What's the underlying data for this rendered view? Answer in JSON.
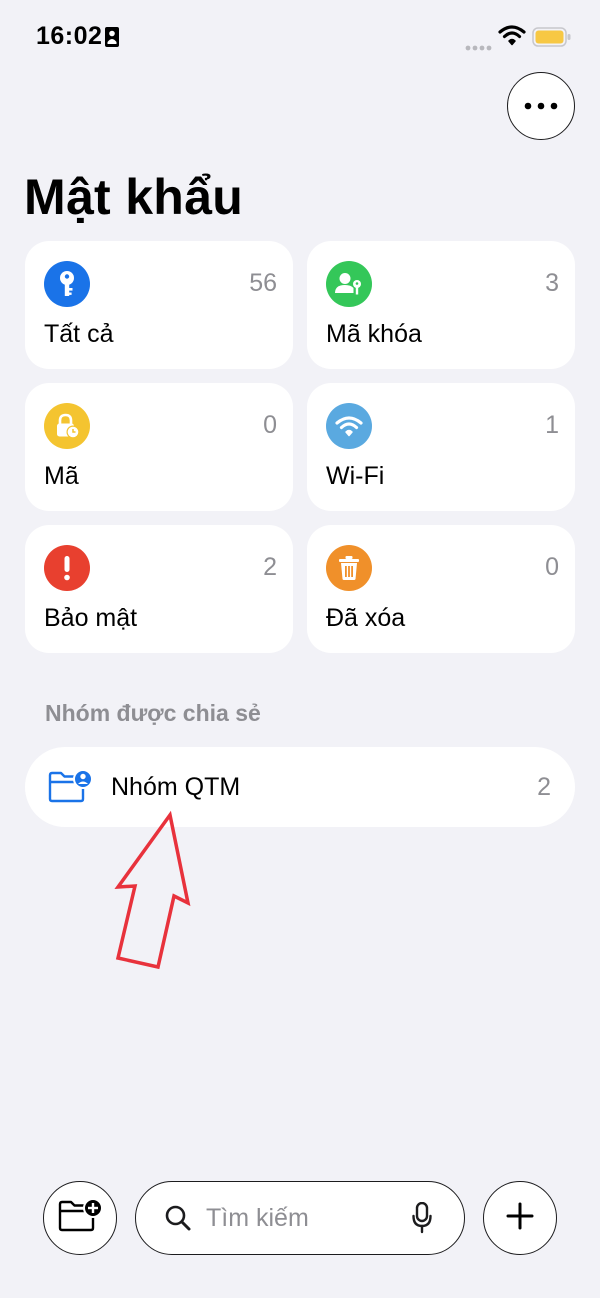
{
  "status_bar": {
    "time": "16:02",
    "icons": [
      "portrait-lock-icon",
      "signal-icon",
      "wifi-icon",
      "battery-icon"
    ],
    "battery_color": "#f7c844"
  },
  "header": {
    "more_icon": "ellipsis-icon",
    "title": "Mật khẩu"
  },
  "categories": [
    {
      "label": "Tất cả",
      "count": "56",
      "icon": "key-icon",
      "color": "#1a73e8"
    },
    {
      "label": "Mã khóa",
      "count": "3",
      "icon": "passkey-person-icon",
      "color": "#34c759"
    },
    {
      "label": "Mã",
      "count": "0",
      "icon": "lock-clock-icon",
      "color": "#f4c430"
    },
    {
      "label": "Wi-Fi",
      "count": "1",
      "icon": "wifi-icon",
      "color": "#5aa9e0"
    },
    {
      "label": "Bảo mật",
      "count": "2",
      "icon": "exclamation-icon",
      "color": "#e8402f"
    },
    {
      "label": "Đã xóa",
      "count": "0",
      "icon": "trash-icon",
      "color": "#f0902a"
    }
  ],
  "shared_section": {
    "header": "Nhóm được chia sẻ",
    "groups": [
      {
        "label": "Nhóm QTM",
        "count": "2",
        "icon": "shared-folder-icon",
        "color": "#1a73e8"
      }
    ]
  },
  "annotation": {
    "icon": "red-arrow-up-icon",
    "color": "#e8323c"
  },
  "bottom_bar": {
    "new_group_icon": "folder-plus-icon",
    "search_icon": "search-icon",
    "search_placeholder": "Tìm kiếm",
    "search_value": "",
    "mic_icon": "microphone-icon",
    "add_icon": "plus-icon"
  }
}
